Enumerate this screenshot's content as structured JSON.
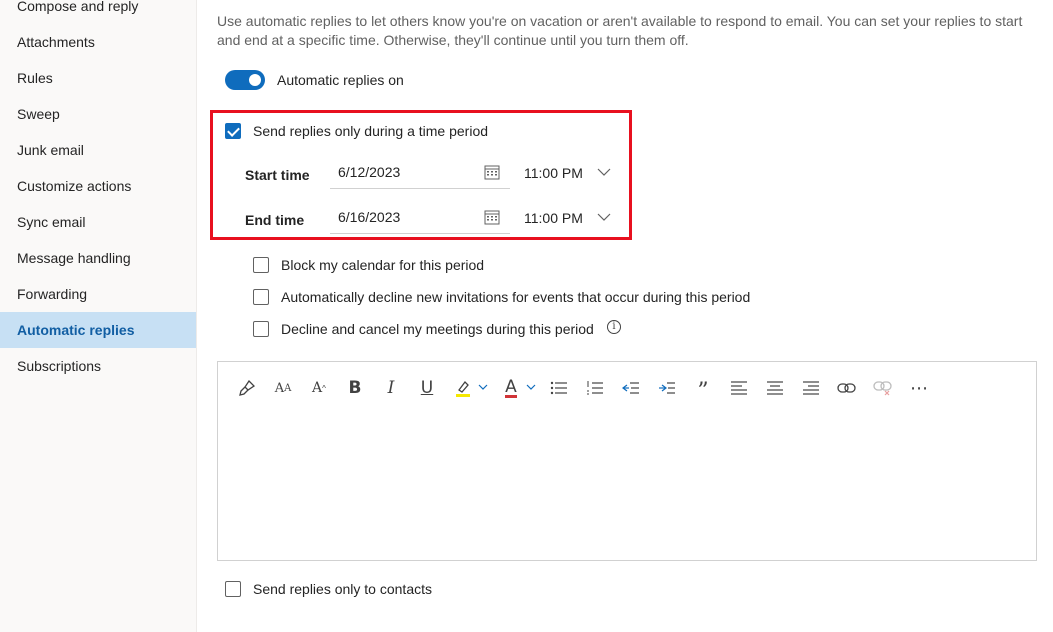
{
  "sidebar": {
    "items": [
      {
        "label": "Compose and reply"
      },
      {
        "label": "Attachments"
      },
      {
        "label": "Rules"
      },
      {
        "label": "Sweep"
      },
      {
        "label": "Junk email"
      },
      {
        "label": "Customize actions"
      },
      {
        "label": "Sync email"
      },
      {
        "label": "Message handling"
      },
      {
        "label": "Forwarding"
      },
      {
        "label": "Automatic replies"
      },
      {
        "label": "Subscriptions"
      }
    ],
    "selected": "Automatic replies"
  },
  "main": {
    "description": "Use automatic replies to let others know you're on vacation or aren't available to respond to email. You can set your replies to start and end at a specific time. Otherwise, they'll continue until you turn them off.",
    "toggle_label": "Automatic replies on",
    "toggle_on": true,
    "time_period_label": "Send replies only during a time period",
    "time_period_checked": true,
    "start_label": "Start time",
    "start_date": "6/12/2023",
    "start_time": "11:00 PM",
    "end_label": "End time",
    "end_date": "6/16/2023",
    "end_time": "11:00 PM",
    "options": [
      {
        "label": "Block my calendar for this period",
        "checked": false
      },
      {
        "label": "Automatically decline new invitations for events that occur during this period",
        "checked": false
      },
      {
        "label": "Decline and cancel my meetings during this period",
        "checked": false
      }
    ],
    "info_icon_glyph": "i",
    "contacts_label": "Send replies only to contacts",
    "contacts_checked": false
  },
  "toolbar": {
    "bold": "B",
    "italic": "I",
    "underline": "U",
    "font_color": "A",
    "quote": "”",
    "more": "⋯",
    "font_size": "A",
    "font_size_sub": "A",
    "grow": "A",
    "grow_sup": "^"
  },
  "colors": {
    "accent": "#0f6cbd",
    "highlight_box": "#e8101f",
    "highlighter": "#f5e800",
    "font_color": "#d13438",
    "selected_nav_bg": "#c7e0f4"
  }
}
